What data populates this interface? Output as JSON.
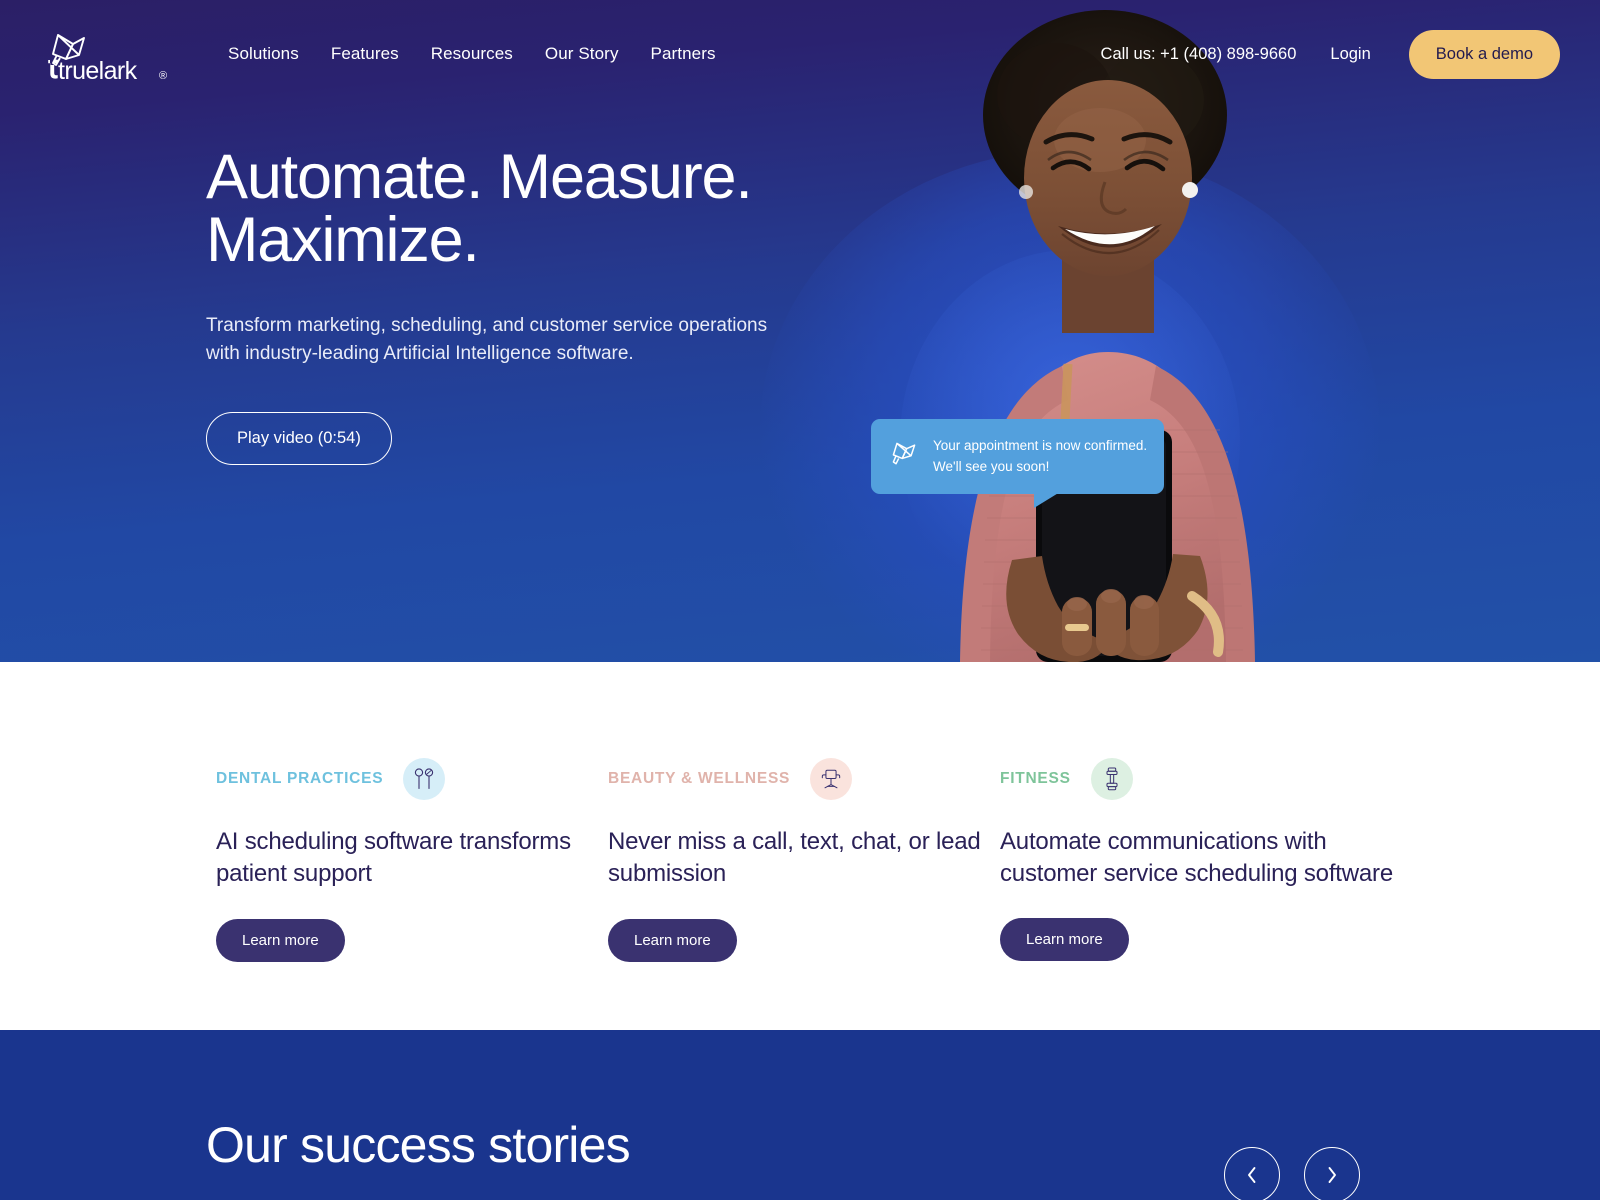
{
  "brand": {
    "name": "truelark",
    "registered_mark": "®",
    "logo_icon": "lark-bird-logo-icon",
    "accent_gold": "#f2c675",
    "deep_navy": "#2a2157",
    "hero_gradient_top": "#2b1f66",
    "hero_gradient_bottom": "#2251a8",
    "stories_bg": "#1a358e"
  },
  "header": {
    "nav": [
      {
        "label": "Solutions"
      },
      {
        "label": "Features"
      },
      {
        "label": "Resources"
      },
      {
        "label": "Our Story"
      },
      {
        "label": "Partners"
      }
    ],
    "call_us": "Call us: +1 (408) 898-9660",
    "login": "Login",
    "demo_button": "Book a demo"
  },
  "hero": {
    "headline_line1": "Automate. Measure.",
    "headline_line2": "Maximize.",
    "subhead": "Transform marketing, scheduling, and customer service operations with industry-leading Artificial Intelligence software.",
    "play_button": "Play video (0:54)",
    "chat_bubble": {
      "icon": "lark-bird-logo-icon",
      "line1": "Your appointment is now confirmed.",
      "line2": "We'll see you soon!",
      "bg_color": "#53a0dd"
    }
  },
  "cards": [
    {
      "eyebrow": "DENTAL PRACTICES",
      "eyebrow_color": "#6ec1de",
      "icon": "dental-tools-icon",
      "icon_bg": "#d6eef8",
      "title": "AI scheduling software transforms patient support",
      "button": "Learn more"
    },
    {
      "eyebrow": "BEAUTY & WELLNESS",
      "eyebrow_color": "#e0b3ab",
      "icon": "salon-chair-icon",
      "icon_bg": "#fae3dd",
      "title": "Never miss a call, text, chat, or lead submission",
      "button": "Learn more"
    },
    {
      "eyebrow": "FITNESS",
      "eyebrow_color": "#7ec49a",
      "icon": "dumbbell-icon",
      "icon_bg": "#ddf0e2",
      "title": "Automate communications with customer service scheduling software",
      "button": "Learn more"
    }
  ],
  "stories": {
    "title": "Our success stories",
    "prev_label": "Previous story",
    "next_label": "Next story"
  }
}
